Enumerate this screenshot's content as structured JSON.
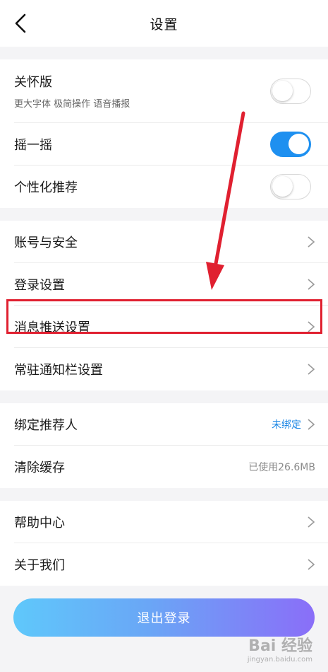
{
  "header": {
    "title": "设置",
    "back_icon": "chevron-left-icon"
  },
  "section1": {
    "care": {
      "label": "关怀版",
      "sub": "更大字体 极简操作 语音播报",
      "enabled": false
    },
    "shake": {
      "label": "摇一摇",
      "enabled": true
    },
    "personalized": {
      "label": "个性化推荐",
      "enabled": false
    }
  },
  "section2": {
    "account": {
      "label": "账号与安全"
    },
    "login": {
      "label": "登录设置"
    },
    "push": {
      "label": "消息推送设置"
    },
    "notif_bar": {
      "label": "常驻通知栏设置"
    }
  },
  "section3": {
    "referrer": {
      "label": "绑定推荐人",
      "value": "未绑定"
    },
    "cache": {
      "label": "清除缓存",
      "value": "已使用26.6MB"
    }
  },
  "section4": {
    "help": {
      "label": "帮助中心"
    },
    "about": {
      "label": "关于我们"
    }
  },
  "logout": {
    "label": "退出登录"
  },
  "watermark": {
    "logo": "Bai 经验",
    "url": "jingyan.baidu.com"
  },
  "colors": {
    "accent": "#1e90f0",
    "highlight": "#e02030"
  }
}
